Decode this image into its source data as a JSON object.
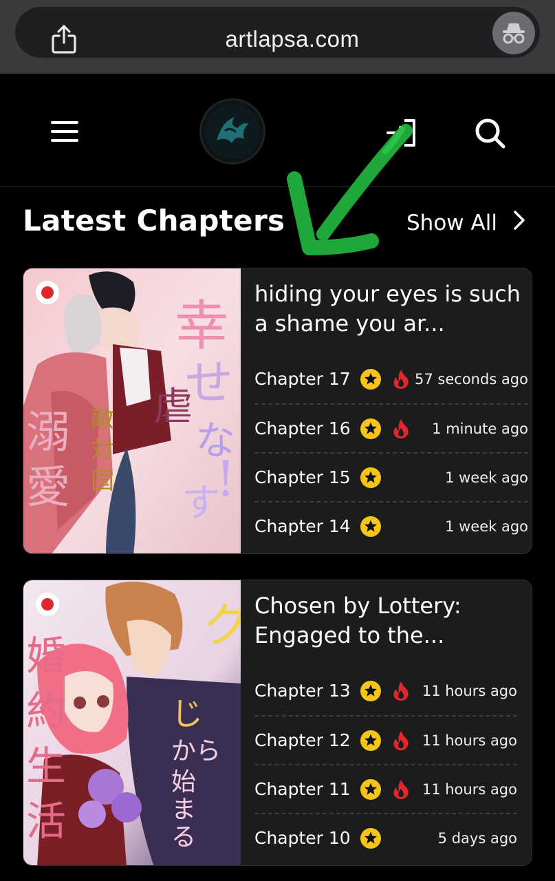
{
  "browser": {
    "url": "artlapsa.com",
    "share_icon": "share-icon",
    "incognito_icon": "incognito-icon"
  },
  "header": {
    "menu_icon": "hamburger-menu-icon",
    "logo": "site-logo",
    "login_icon": "login-icon",
    "search_icon": "search-icon"
  },
  "section": {
    "title": "Latest Chapters",
    "show_all": "Show All"
  },
  "colors": {
    "background": "#000000",
    "card": "#1c1c1d",
    "star": "#f5c518",
    "fire": "#e0262f",
    "annotation": "#1fa83a"
  },
  "cards": [
    {
      "title": "hiding your eyes is such a shame you ar...",
      "chapters": [
        {
          "label": "Chapter 17",
          "hot": true,
          "time": "57 seconds ago"
        },
        {
          "label": "Chapter 16",
          "hot": true,
          "time": "1 minute ago"
        },
        {
          "label": "Chapter 15",
          "hot": false,
          "time": "1 week ago"
        },
        {
          "label": "Chapter 14",
          "hot": false,
          "time": "1 week ago"
        }
      ]
    },
    {
      "title": "Chosen by Lottery: Engaged to the...",
      "chapters": [
        {
          "label": "Chapter 13",
          "hot": true,
          "time": "11 hours ago"
        },
        {
          "label": "Chapter 12",
          "hot": true,
          "time": "11 hours ago"
        },
        {
          "label": "Chapter 11",
          "hot": true,
          "time": "11 hours ago"
        },
        {
          "label": "Chapter 10",
          "hot": false,
          "time": "5 days ago"
        }
      ]
    }
  ]
}
